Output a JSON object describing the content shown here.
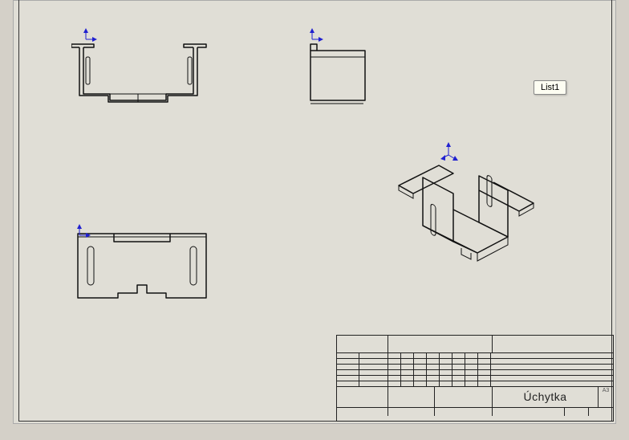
{
  "tooltip": {
    "label": "List1"
  },
  "titleblock": {
    "part_name": "Úchytka",
    "sheet_size": "A3",
    "header_cells": {
      "left1": "",
      "left2": "",
      "right1": ""
    },
    "small_rows": [
      "",
      "",
      "",
      "",
      "",
      "",
      ""
    ]
  },
  "views": {
    "front": {
      "exists": true
    },
    "side": {
      "exists": true
    },
    "flat": {
      "exists": true
    },
    "iso": {
      "exists": true
    }
  }
}
